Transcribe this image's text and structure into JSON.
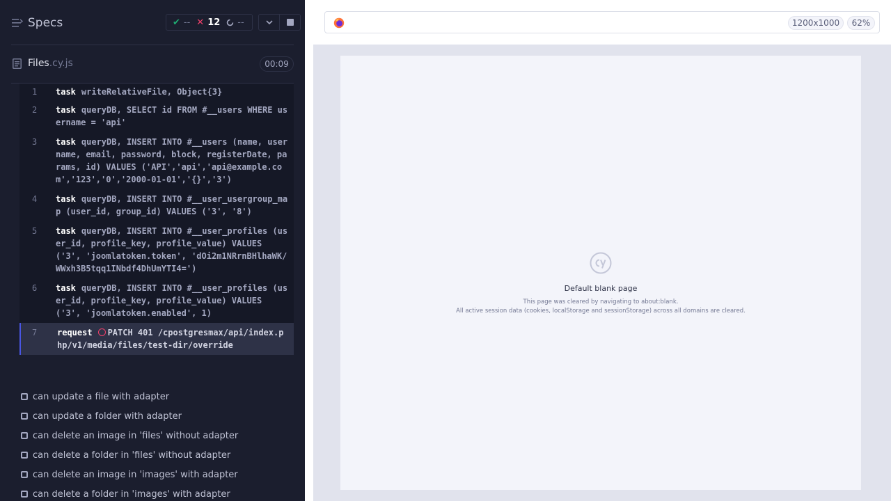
{
  "reporter": {
    "header": {
      "title": "Specs",
      "stats": {
        "passed": "--",
        "failed": "12",
        "pending": "--"
      }
    },
    "spec": {
      "file_base": "Files",
      "file_ext": ".cy.js",
      "duration": "00:09"
    },
    "commands": [
      {
        "num": "1",
        "name": "task",
        "message": "writeRelativeFile, Object{3}"
      },
      {
        "num": "2",
        "name": "task",
        "message": "queryDB, SELECT id FROM #__users WHERE username = 'api'"
      },
      {
        "num": "3",
        "name": "task",
        "message": "queryDB, INSERT INTO #__users (name, username, email, password, block, registerDate, params, id) VALUES ('API','api','api@example.com','123','0','2000-01-01','{}','3')"
      },
      {
        "num": "4",
        "name": "task",
        "message": "queryDB, INSERT INTO #__user_usergroup_map (user_id, group_id) VALUES ('3', '8')"
      },
      {
        "num": "5",
        "name": "task",
        "message": "queryDB, INSERT INTO #__user_profiles (user_id, profile_key, profile_value) VALUES ('3', 'joomlatoken.token', 'dOi2m1NRrnBHlhaWK/WWxh3B5tqq1INbdf4DhUmYTI4=')"
      },
      {
        "num": "6",
        "name": "task",
        "message": "queryDB, INSERT INTO #__user_profiles (user_id, profile_key, profile_value) VALUES ('3', 'joomlatoken.enabled', 1)"
      },
      {
        "num": "7",
        "name": "request",
        "message": "PATCH 401 /cpostgresmax/api/index.php/v1/media/files/test-dir/override"
      }
    ],
    "tests": [
      {
        "title": "can update a file with adapter"
      },
      {
        "title": "can update a folder with adapter"
      },
      {
        "title": "can delete an image in 'files' without adapter"
      },
      {
        "title": "can delete a folder in 'files' without adapter"
      },
      {
        "title": "can delete an image in 'images' with adapter"
      },
      {
        "title": "can delete a folder in 'images' with adapter"
      }
    ]
  },
  "aut": {
    "viewport_size": "1200x1000",
    "zoom": "62%",
    "blank_page": {
      "title": "Default blank page",
      "line1": "This page was cleared by navigating to about:blank.",
      "line2": "All active session data (cookies, localStorage and sessionStorage) across all domains are cleared."
    }
  },
  "colors": {
    "reporter_bg": "#1b1e2e",
    "pass": "#1fa971",
    "fail": "#f0406a",
    "accent": "#4956e3"
  }
}
